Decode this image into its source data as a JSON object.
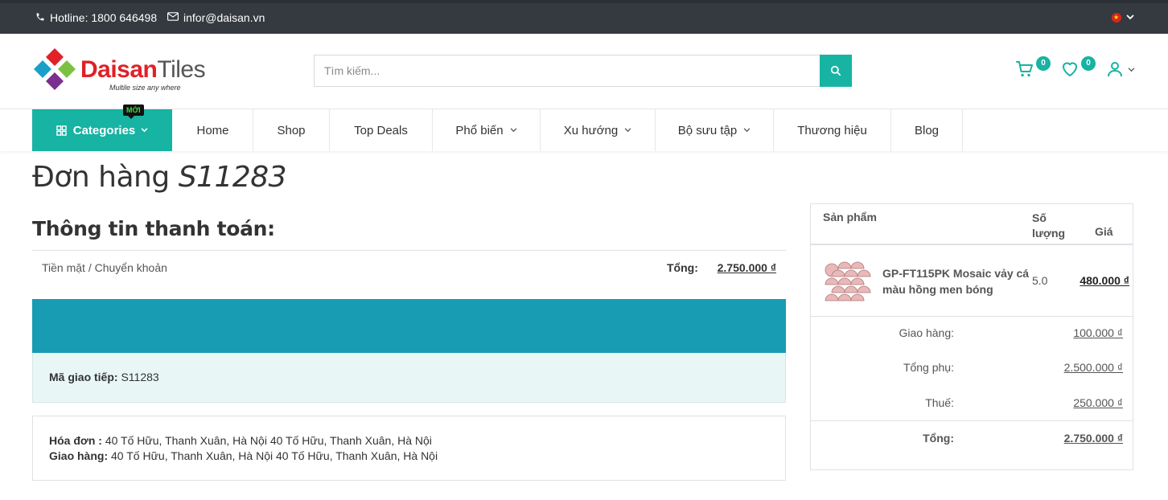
{
  "topbar": {
    "hotline": "Hotline: 1800 646498",
    "email": "infor@daisan.vn",
    "language_icon": "vn-flag-icon"
  },
  "header": {
    "logo_brand_part1": "Daisan",
    "logo_brand_part2": "Tiles",
    "logo_tagline": "Multile size any where",
    "search_placeholder": "Tìm kiếm...",
    "search_value": "",
    "cart_count": "0",
    "wishlist_count": "0"
  },
  "nav": {
    "categories_label": "Categories",
    "new_badge": "MỚI",
    "items": [
      {
        "label": "Home"
      },
      {
        "label": "Shop"
      },
      {
        "label": "Top Deals"
      },
      {
        "label": "Phổ biến"
      },
      {
        "label": "Xu hướng"
      },
      {
        "label": "Bộ sưu tập"
      },
      {
        "label": "Thương hiệu"
      },
      {
        "label": "Blog"
      }
    ]
  },
  "order": {
    "title_prefix": "Đơn hàng",
    "order_code": "S11283",
    "payment_section_title": "Thông tin thanh toán:",
    "payment_method": "Tiền mặt / Chuyển khoản",
    "total_label": "Tổng:",
    "total_value": "2.750.000 ₫",
    "reference_label": "Mã giao tiếp:",
    "reference_value": "S11283",
    "invoice_label": "Hóa đơn :",
    "invoice_address": "40 Tố Hữu, Thanh Xuân, Hà Nội 40 Tố Hữu, Thanh Xuân, Hà Nội",
    "shipping_label": "Giao hàng:",
    "shipping_address": "40 Tố Hữu, Thanh Xuân, Hà Nội 40 Tố Hữu, Thanh Xuân, Hà Nội"
  },
  "summary": {
    "col_product": "Sản phẩm",
    "col_qty_line1": "Số",
    "col_qty_line2": "lượng",
    "col_price": "Giá",
    "product_name": "GP-FT115PK Mosaic vảy cá màu hồng men bóng",
    "product_qty": "5.0",
    "product_price": "480.000 ₫",
    "shipping_label": "Giao hàng:",
    "shipping_value": "100.000 ₫",
    "subtotal_label": "Tổng phụ:",
    "subtotal_value": "2.500.000 ₫",
    "tax_label": "Thuế:",
    "tax_value": "250.000 ₫",
    "total_label": "Tổng:",
    "total_value": "2.750.000 ₫"
  },
  "colors": {
    "accent": "#17b3a3",
    "topbar": "#343a40",
    "banner": "#179cb3",
    "light_panel": "#e8f6f6"
  }
}
